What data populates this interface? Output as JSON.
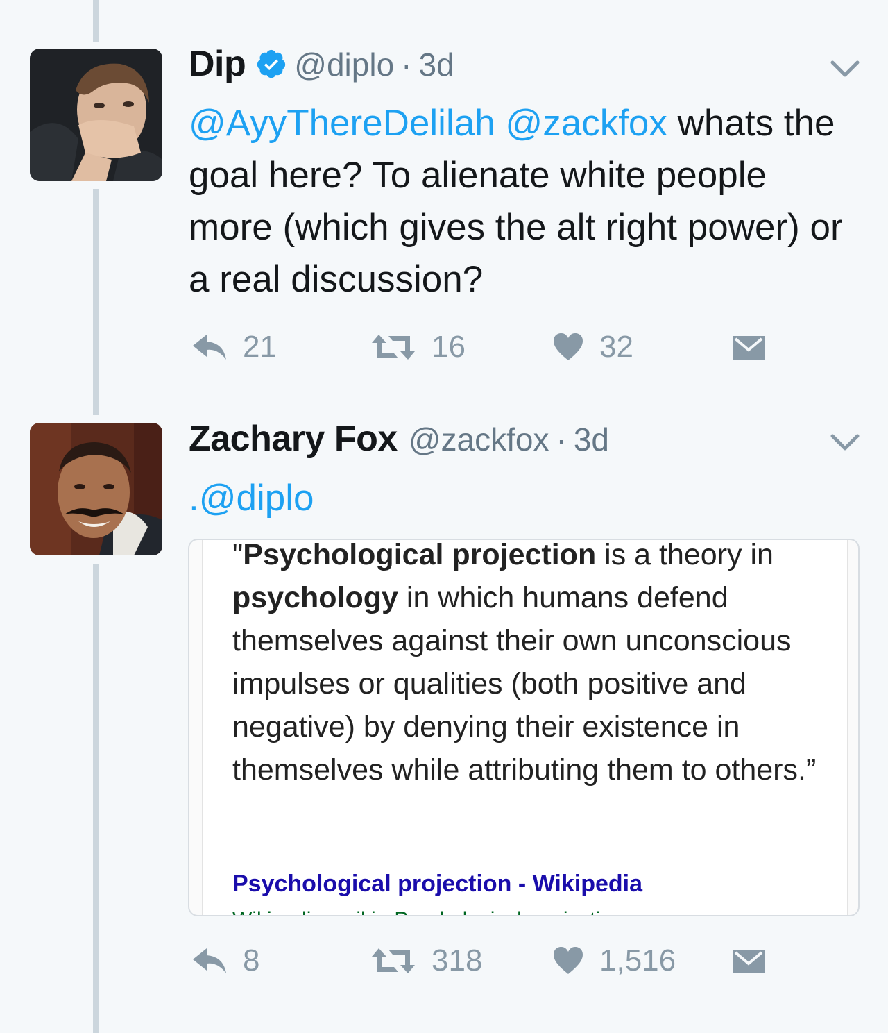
{
  "tweets": [
    {
      "name": "Dip",
      "verified": true,
      "handle": "@diplo",
      "separator": "·",
      "time": "3d",
      "text_mentions": [
        "@AyyThereDelilah",
        "@zackfox"
      ],
      "text_body": " whats the goal here? To alienate white people more (which gives the alt right power) or a real discussion?",
      "actions": {
        "replies": "21",
        "retweets": "16",
        "likes": "32"
      }
    },
    {
      "name": "Zachary Fox",
      "handle": "@zackfox",
      "separator": "·",
      "time": "3d",
      "text_prefix": ".",
      "text_mention": "@diplo",
      "card": {
        "quote_open": "\"",
        "quote_bold_1": "Psychological projection",
        "quote_part_1": " is a theory in ",
        "quote_bold_2": "psychology",
        "quote_part_2": " in which humans defend themselves against their own unconscious impulses or qualities (both positive and negative) by denying their existence in themselves while attributing them to others.”",
        "link_title": "Psychological projection - Wikipedia",
        "link_sub": "Wikipedia › wiki › Psychological_projection"
      },
      "actions": {
        "replies": "8",
        "retweets": "318",
        "likes": "1,516"
      }
    }
  ],
  "colors": {
    "link": "#1da1f2",
    "muted": "#8899a6",
    "verified": "#1da1f2",
    "background": "#f5f8fa",
    "wiki_link": "#1a0dab",
    "wiki_sub": "#006621"
  },
  "icons": [
    "verified-badge-icon",
    "chevron-down-icon",
    "reply-icon",
    "retweet-icon",
    "like-icon",
    "dm-icon"
  ]
}
